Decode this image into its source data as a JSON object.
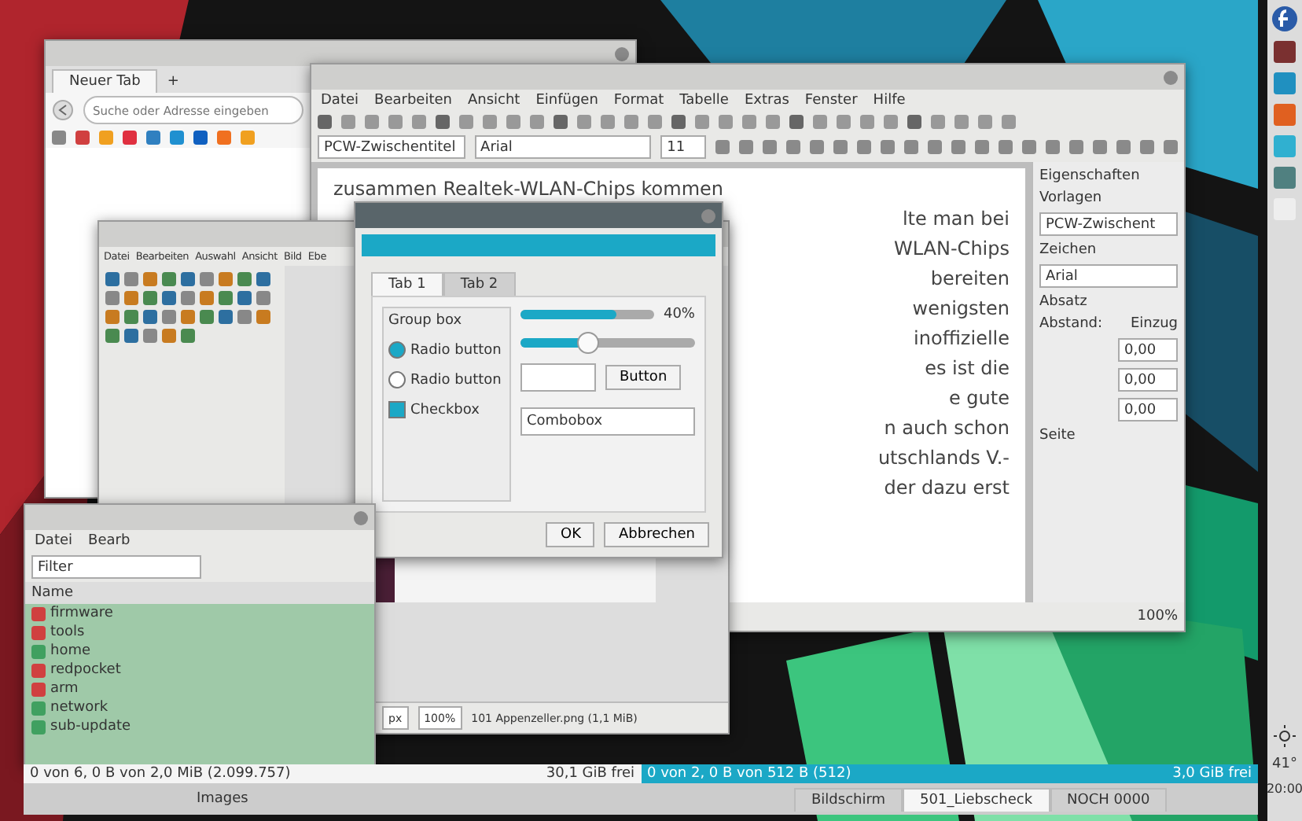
{
  "browser": {
    "tab": "Neuer Tab",
    "new_tab": "+",
    "search": {
      "placeholder": "Suche oder Adresse eingeben"
    }
  },
  "writer": {
    "menu": [
      "Datei",
      "Bearbeiten",
      "Ansicht",
      "Einfügen",
      "Format",
      "Tabelle",
      "Extras",
      "Fenster",
      "Hilfe"
    ],
    "style": "PCW-Zwischentitel",
    "font": "Arial",
    "size": "11",
    "lines": [
      "zusammen Realtek-WLAN-Chips kommen",
      "lte man bei",
      "WLAN-Chips",
      "bereiten",
      "wenigsten",
      "inoffizielle",
      "es ist die",
      "e gute",
      "n auch schon",
      "utschlands V.-",
      "der dazu erst"
    ],
    "sidebar": {
      "title": "Eigenschaften",
      "sections": [
        {
          "label": "Vorlagen",
          "value": "PCW-Zwischent"
        },
        {
          "label": "Zeichen",
          "value": "Arial"
        },
        {
          "label": "Absatz"
        }
      ],
      "spacing": "Abstand:",
      "indent": "Einzug",
      "values": [
        "0,00",
        "0,00",
        "0,00"
      ],
      "page": "Seite"
    },
    "zoom": "100%"
  },
  "gimp": {
    "menu": [
      "Datei",
      "Bearbeiten",
      "Auswahl",
      "Ansicht",
      "Bild",
      "Ebe"
    ],
    "unit": "px",
    "zoom": "100%",
    "file": "101 Appenzeller.png (1,1 MiB)"
  },
  "dialog": {
    "tabs": [
      {
        "label": "Tab 1",
        "selected": true
      },
      {
        "label": "Tab 2",
        "selected": false
      }
    ],
    "group": "Group box",
    "progress": {
      "level": 0.72,
      "reading": "40%"
    },
    "slider": {
      "level": 0.38
    },
    "radios": [
      {
        "label": "Radio button",
        "selected": true
      },
      {
        "label": "Radio button",
        "selected": false
      }
    ],
    "checkbox": {
      "label": "Checkbox",
      "checked": true
    },
    "button": "Button",
    "combo": "Combobox",
    "actions": [
      "OK",
      "Abbrechen"
    ]
  },
  "files": {
    "menu": [
      "Datei",
      "Bearb"
    ],
    "filter": "Filter",
    "column": "Name",
    "items": [
      {
        "name": "firmware",
        "color": "#d04040"
      },
      {
        "name": "tools",
        "color": "#d04040"
      },
      {
        "name": "home",
        "color": "#40a060"
      },
      {
        "name": "redpocket",
        "color": "#d04040"
      },
      {
        "name": "arm",
        "color": "#d04040"
      },
      {
        "name": "network",
        "color": "#40a060"
      },
      {
        "name": "sub-update",
        "color": "#40a060"
      }
    ],
    "status_left": "0 von 6, 0 B von 2,0 MiB (2.099.757)",
    "free_left": "30,1 GiB frei",
    "status_right": "0 von 2, 0 B von 512 B (512)",
    "free_right": "3,0 GiB frei",
    "place": "Images",
    "tabs": [
      {
        "label": "Bildschirm",
        "selected": false
      },
      {
        "label": "501_Liebscheck",
        "selected": true
      },
      {
        "label": "NOCH 0000",
        "selected": false
      }
    ]
  },
  "panel": {
    "temperature": "41°",
    "clock": "20:00"
  }
}
